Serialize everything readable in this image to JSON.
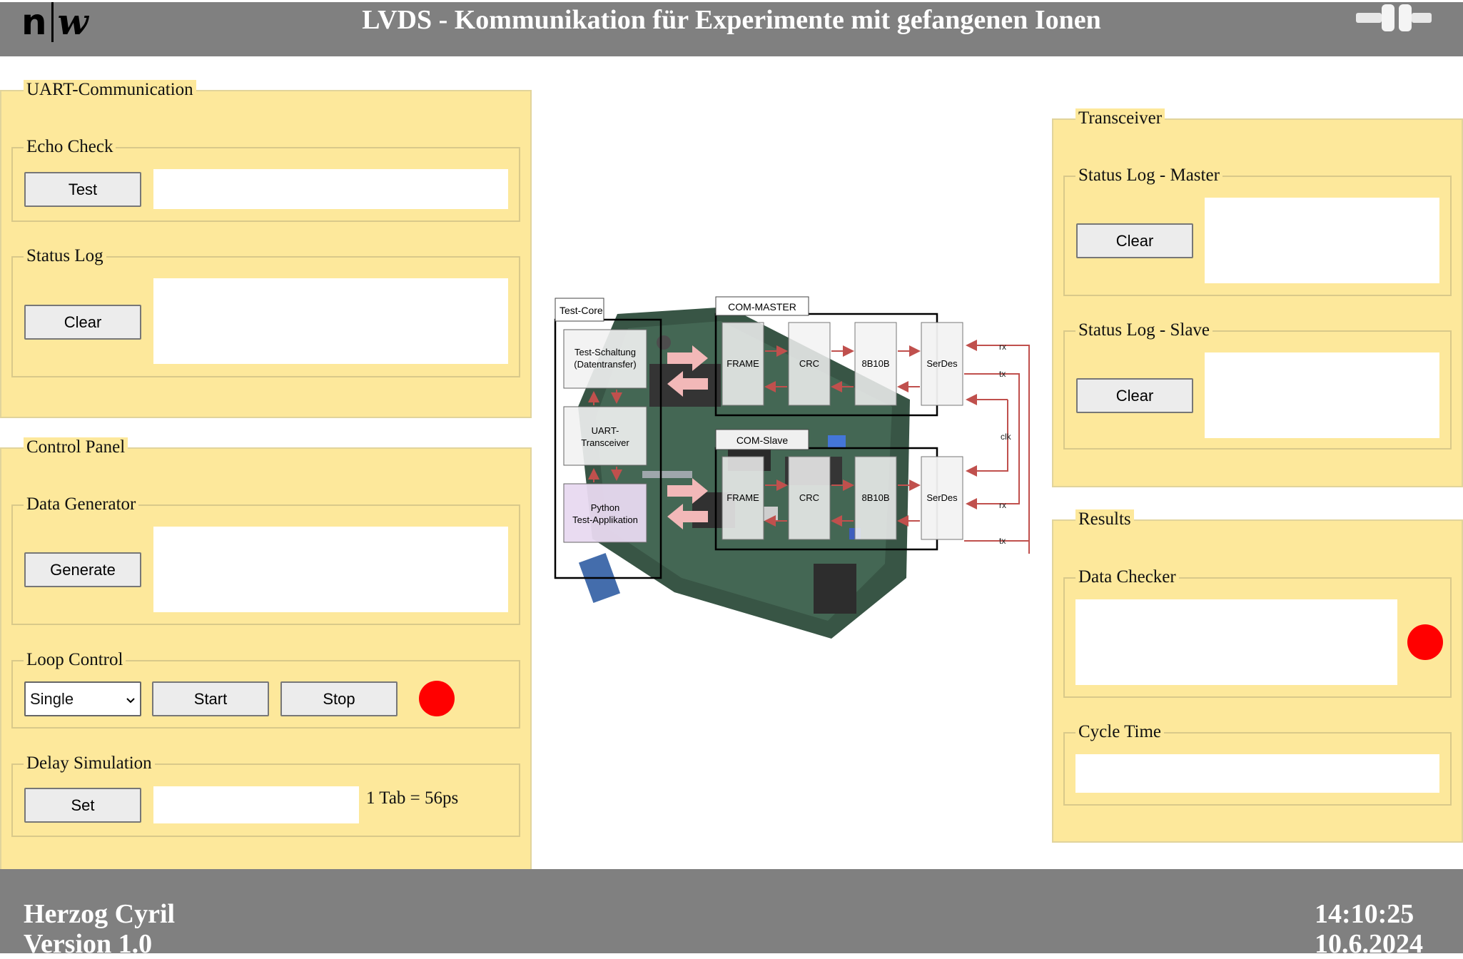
{
  "header": {
    "logo_n": "n",
    "logo_w": "w",
    "title": "LVDS - Kommunikation für Experimente mit gefangenen Ionen",
    "right_icon": "plug-icon"
  },
  "uart": {
    "title": "UART-Communication",
    "echo_check": {
      "title": "Echo Check",
      "button": "Test",
      "value": ""
    },
    "status_log": {
      "title": "Status Log",
      "button": "Clear",
      "value": ""
    }
  },
  "control": {
    "title": "Control Panel",
    "data_generator": {
      "title": "Data Generator",
      "button": "Generate",
      "value": ""
    },
    "loop_control": {
      "title": "Loop Control",
      "mode_selected": "Single",
      "start": "Start",
      "stop": "Stop",
      "status_color": "#ff0000"
    },
    "delay": {
      "title": "Delay Simulation",
      "button": "Set",
      "value": "",
      "note": "1 Tab = 56ps"
    }
  },
  "transceiver": {
    "title": "Transceiver",
    "master": {
      "title": "Status Log - Master",
      "button": "Clear",
      "value": ""
    },
    "slave": {
      "title": "Status Log - Slave",
      "button": "Clear",
      "value": ""
    }
  },
  "results": {
    "title": "Results",
    "checker": {
      "title": "Data Checker",
      "value": "",
      "status_color": "#ff0000"
    },
    "cycle": {
      "title": "Cycle Time",
      "value": ""
    }
  },
  "diagram": {
    "test_core": "Test-Core",
    "test_schaltung_1": "Test-Schaltung",
    "test_schaltung_2": "(Datentransfer)",
    "uart_1": "UART-",
    "uart_2": "Transceiver",
    "python_1": "Python",
    "python_2": "Test-Applikation",
    "com_master": "COM-MASTER",
    "com_slave": "COM-Slave",
    "frame": "FRAME",
    "crc": "CRC",
    "enc": "8B10B",
    "serdes": "SerDes",
    "rx": "rx",
    "tx": "tx",
    "clk": "clk"
  },
  "footer": {
    "author": "Herzog Cyril",
    "version": "Version 1.0",
    "time": "14:10:25",
    "date": "10.6.2024"
  },
  "colors": {
    "header_bg": "#808080",
    "panel_bg": "#fde89b",
    "led": "#ff0000",
    "arrow": "#c0504d"
  }
}
